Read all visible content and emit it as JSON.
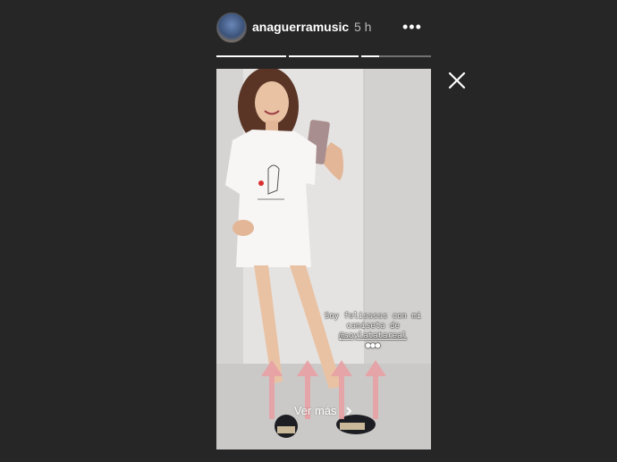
{
  "header": {
    "username": "anaguerramusic",
    "time": "5 h",
    "more_icon": "more-dots-icon"
  },
  "progress": [
    {
      "fill": 1.0
    },
    {
      "fill": 1.0
    },
    {
      "fill": 0.25
    }
  ],
  "story": {
    "caption_line1": "Soy felisssss con mi",
    "caption_line2": "camiseta de",
    "mention": "@soylatatareal",
    "cta_label": "Ver más",
    "cta_icon": "chevron-right-icon"
  },
  "colors": {
    "background": "#262626",
    "arrow": "#e8a0a4",
    "text": "#ffffff"
  },
  "close_icon": "close-icon"
}
